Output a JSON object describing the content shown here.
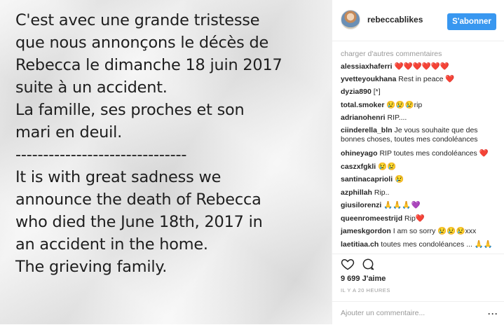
{
  "photo": {
    "lines": [
      "C'est avec une grande tristesse",
      "que nous annonçons le décès de",
      "Rebecca le dimanche 18 juin 2017",
      "suite à un accident.",
      "La famille, ses proches et son",
      "mari en deuil.",
      "-------------------------------",
      "It is with great sadness we",
      "announce the death of Rebecca",
      "who died the June 18th, 2017 in",
      "an accident in the home.",
      "The grieving family."
    ]
  },
  "header": {
    "username": "rebeccablikes",
    "follow_label": "S'abonner"
  },
  "comments": {
    "load_more": "charger d'autres commentaires",
    "items": [
      {
        "user": "alessiaxhaferri",
        "text": "❤️❤️❤️❤️❤️❤️"
      },
      {
        "user": "yvetteyoukhana",
        "text": "Rest in peace ❤️"
      },
      {
        "user": "dyzia890",
        "text": "[*]"
      },
      {
        "user": "total.smoker",
        "text": "😢😢😢rip"
      },
      {
        "user": "adrianohenri",
        "text": "RIP...."
      },
      {
        "user": "ciinderella_bln",
        "text": "Je vous souhaite que des bonnes choses, toutes mes condoléances"
      },
      {
        "user": "ohineyago",
        "text": "RIP toutes mes condoléances ❤️"
      },
      {
        "user": "caszxfgkli",
        "text": "😢😢"
      },
      {
        "user": "santinacaprioli",
        "text": "😢"
      },
      {
        "user": "azphillah",
        "text": "Rip.."
      },
      {
        "user": "giusilorenzi",
        "text": "🙏🙏🙏💜"
      },
      {
        "user": "queenromeestrijd",
        "text": "Rip❤️"
      },
      {
        "user": "jamesk­gordon",
        "text": "I am so sorry 😢😢😢xxx"
      },
      {
        "user": "laetitiaa.ch",
        "text": "toutes mes condoléances ... 🙏🙏"
      }
    ]
  },
  "actions": {
    "heart_icon": "heart-outline-icon",
    "comment_icon": "comment-bubble-icon"
  },
  "likes": "9 699 J'aime",
  "time": "IL Y A 20 HEURES",
  "add_comment": {
    "placeholder": "Ajouter un commentaire...",
    "more_icon": "more-dots-icon"
  },
  "colors": {
    "accent": "#3897f0",
    "text": "#262626",
    "muted": "#999999",
    "heart": "#ed4956"
  }
}
